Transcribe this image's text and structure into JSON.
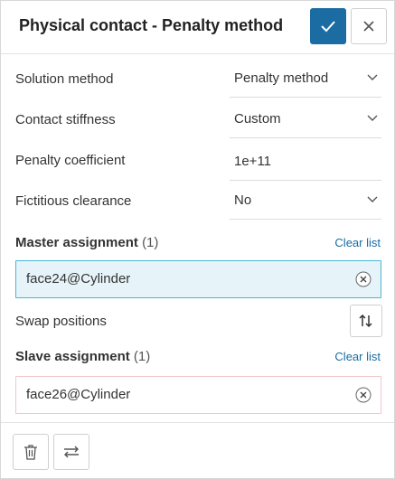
{
  "header": {
    "title": "Physical contact - Penalty method",
    "confirm_icon": "check-icon",
    "close_icon": "close-icon"
  },
  "fields": {
    "solution_method": {
      "label": "Solution method",
      "value": "Penalty method"
    },
    "contact_stiffness": {
      "label": "Contact stiffness",
      "value": "Custom"
    },
    "penalty_coefficient": {
      "label": "Penalty coefficient",
      "value": "1e+11"
    },
    "fictitious_clearance": {
      "label": "Fictitious clearance",
      "value": "No"
    }
  },
  "master": {
    "label": "Master assignment",
    "count": "(1)",
    "clear": "Clear list",
    "item": "face24@Cylinder"
  },
  "swap": {
    "label": "Swap positions",
    "icon": "swap-vertical-icon"
  },
  "slave": {
    "label": "Slave assignment",
    "count": "(1)",
    "clear": "Clear list",
    "item": "face26@Cylinder"
  },
  "footer": {
    "delete_icon": "trash-icon",
    "switch_icon": "swap-horizontal-icon"
  },
  "colors": {
    "primary": "#1a6ca3",
    "master_bg": "#e6f4fa",
    "master_border": "#4bb5d3",
    "slave_border": "#f0c6cc"
  }
}
